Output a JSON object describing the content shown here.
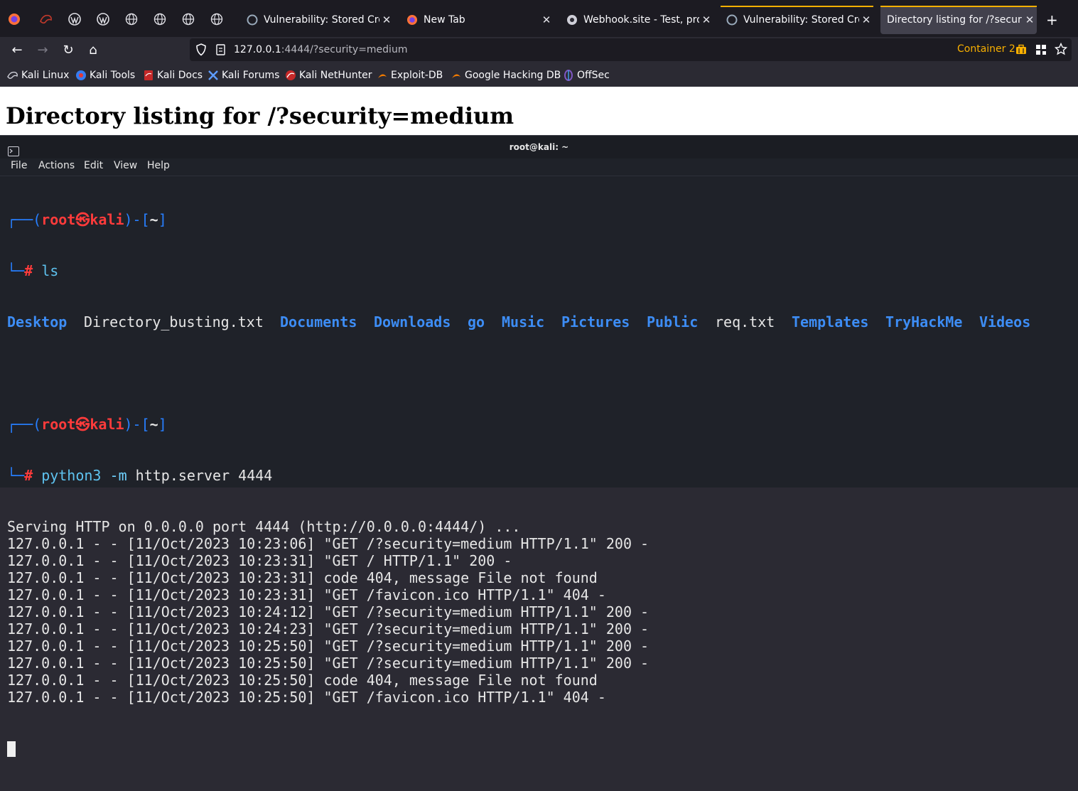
{
  "browser": {
    "tabs": [
      {
        "title": "Vulnerability: Stored Cross",
        "close": "✕"
      },
      {
        "title": "New Tab",
        "close": "✕"
      },
      {
        "title": "Webhook.site - Test, proc",
        "close": "✕"
      },
      {
        "title": "Vulnerability: Stored Cross",
        "close": "✕"
      },
      {
        "title": "Directory listing for /?security",
        "close": "✕"
      }
    ],
    "new_tab": "+",
    "url_host": "127.0.0.1",
    "url_rest": ":4444/?security=medium",
    "container": "Container 2",
    "bookmarks": [
      "Kali Linux",
      "Kali Tools",
      "Kali Docs",
      "Kali Forums",
      "Kali NetHunter",
      "Exploit-DB",
      "Google Hacking DB",
      "OffSec"
    ]
  },
  "page": {
    "heading": "Directory listing for /?security=medium"
  },
  "terminal": {
    "title": "root@kali: ~",
    "menu": [
      "File",
      "Actions",
      "Edit",
      "View",
      "Help"
    ],
    "prompt": {
      "open": "┌──(",
      "user": "root",
      "skull": "㉿",
      "host": "kali",
      "close": ")-[",
      "path": "~",
      "end": "]",
      "hash_prefix": "└─",
      "hash": "#"
    },
    "cmd1": "ls",
    "ls_output": [
      {
        "name": "Desktop",
        "dir": true
      },
      {
        "name": "Directory_busting.txt",
        "dir": false
      },
      {
        "name": "Documents",
        "dir": true
      },
      {
        "name": "Downloads",
        "dir": true
      },
      {
        "name": "go",
        "dir": true
      },
      {
        "name": "Music",
        "dir": true
      },
      {
        "name": "Pictures",
        "dir": true
      },
      {
        "name": "Public",
        "dir": true
      },
      {
        "name": "req.txt",
        "dir": false
      },
      {
        "name": "Templates",
        "dir": true
      },
      {
        "name": "TryHackMe",
        "dir": true
      },
      {
        "name": "Videos",
        "dir": true
      }
    ],
    "cmd2_prog": "python3",
    "cmd2_opt": "-m",
    "cmd2_args": "http.server 4444",
    "log": [
      "Serving HTTP on 0.0.0.0 port 4444 (http://0.0.0.0:4444/) ...",
      "127.0.0.1 - - [11/Oct/2023 10:23:06] \"GET /?security=medium HTTP/1.1\" 200 -",
      "127.0.0.1 - - [11/Oct/2023 10:23:31] \"GET / HTTP/1.1\" 200 -",
      "127.0.0.1 - - [11/Oct/2023 10:23:31] code 404, message File not found",
      "127.0.0.1 - - [11/Oct/2023 10:23:31] \"GET /favicon.ico HTTP/1.1\" 404 -",
      "127.0.0.1 - - [11/Oct/2023 10:24:12] \"GET /?security=medium HTTP/1.1\" 200 -",
      "127.0.0.1 - - [11/Oct/2023 10:24:23] \"GET /?security=medium HTTP/1.1\" 200 -",
      "127.0.0.1 - - [11/Oct/2023 10:25:50] \"GET /?security=medium HTTP/1.1\" 200 -",
      "127.0.0.1 - - [11/Oct/2023 10:25:50] \"GET /?security=medium HTTP/1.1\" 200 -",
      "127.0.0.1 - - [11/Oct/2023 10:25:50] code 404, message File not found",
      "127.0.0.1 - - [11/Oct/2023 10:25:50] \"GET /favicon.ico HTTP/1.1\" 404 -"
    ]
  }
}
